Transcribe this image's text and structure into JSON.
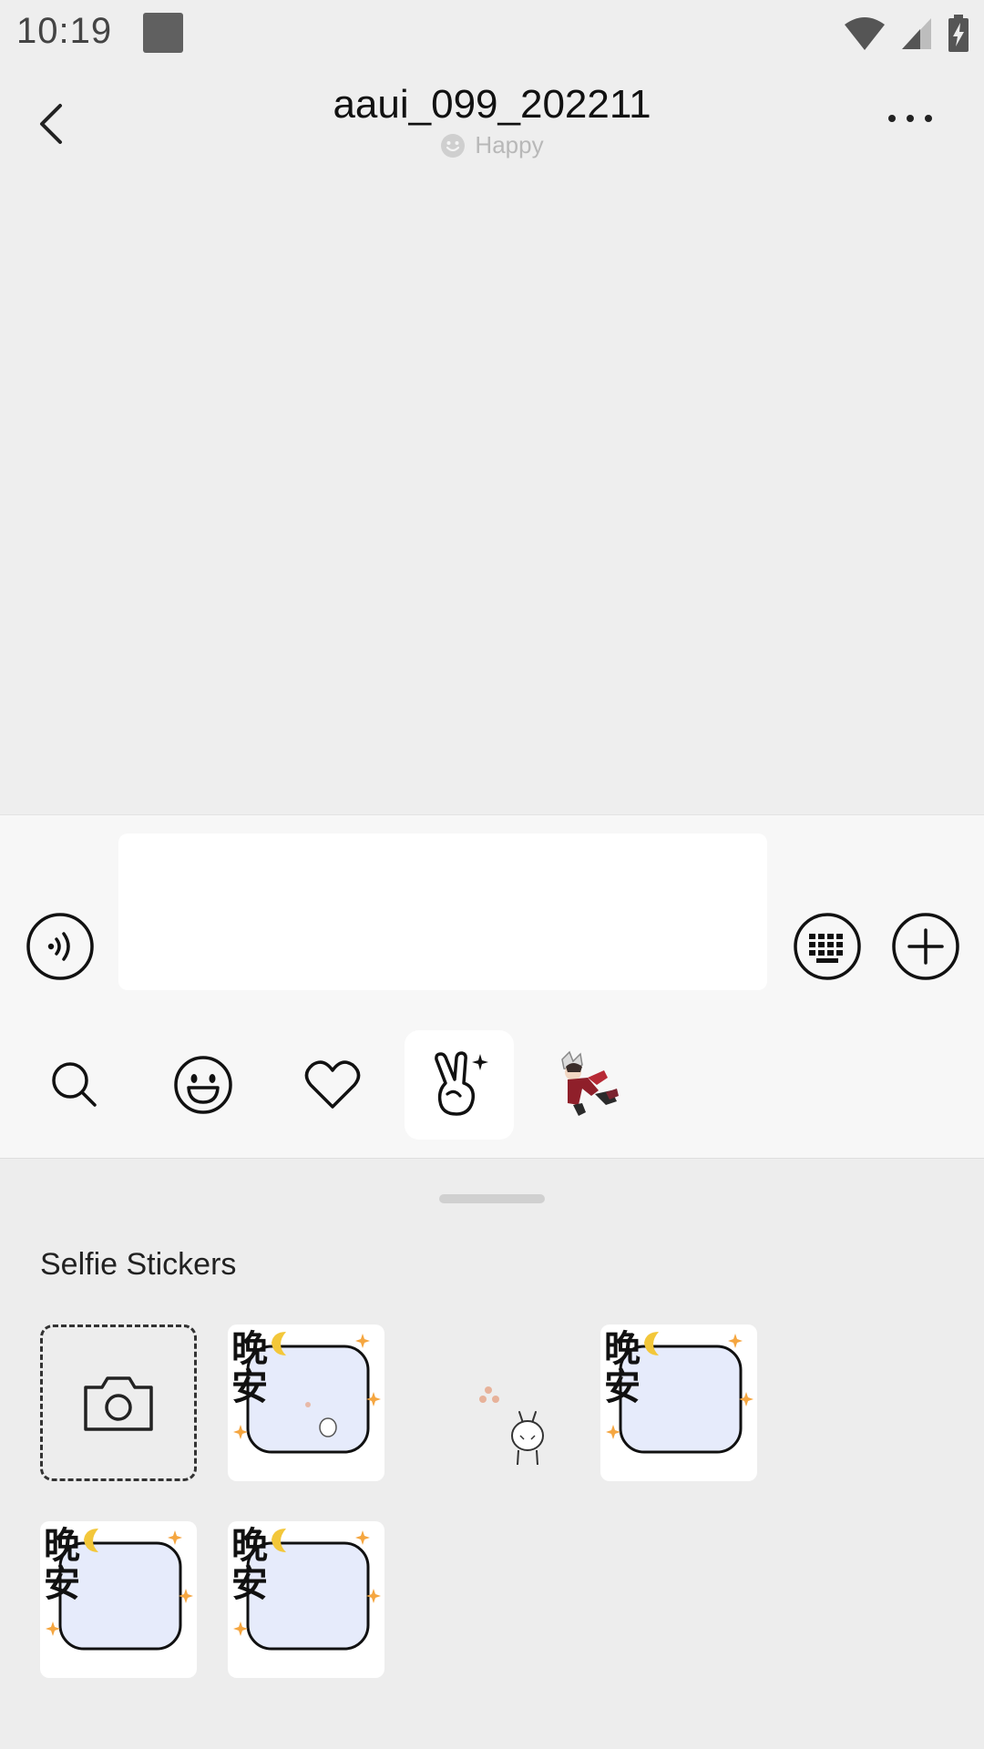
{
  "status_bar": {
    "time": "10:19",
    "icons": [
      "wifi-icon",
      "cell-signal-icon",
      "battery-charging-icon"
    ]
  },
  "header": {
    "title": "aaui_099_202211",
    "status_icon": "smiley-icon",
    "status_text": "Happy",
    "more_icon": "more-dots-icon",
    "back_icon": "chevron-left-icon"
  },
  "composer": {
    "input_value": "",
    "voice_icon": "voice-icon",
    "keyboard_icon": "keyboard-icon",
    "plus_icon": "plus-icon"
  },
  "sticker_tabs": [
    {
      "icon": "search-icon",
      "active": false
    },
    {
      "icon": "emoji-smiley-icon",
      "active": false
    },
    {
      "icon": "heart-icon",
      "active": false
    },
    {
      "icon": "peace-hand-sparkle-icon",
      "active": true
    },
    {
      "icon": "character-sticker-pack-icon",
      "active": false
    }
  ],
  "panel": {
    "section_title": "Selfie Stickers",
    "stickers": [
      {
        "type": "camera",
        "icon": "camera-icon"
      },
      {
        "type": "goodnight",
        "text": "晚安"
      },
      {
        "type": "bunny",
        "text": ""
      },
      {
        "type": "goodnight",
        "text": "晚安"
      },
      {
        "type": "goodnight",
        "text": "晚安"
      },
      {
        "type": "goodnight",
        "text": "晚安"
      }
    ]
  },
  "colors": {
    "background": "#eeeeee",
    "input_area": "#f7f7f7",
    "sticker_card": "#e6ebfb",
    "moon": "#f3c73a",
    "sparkle": "#f5a640"
  }
}
